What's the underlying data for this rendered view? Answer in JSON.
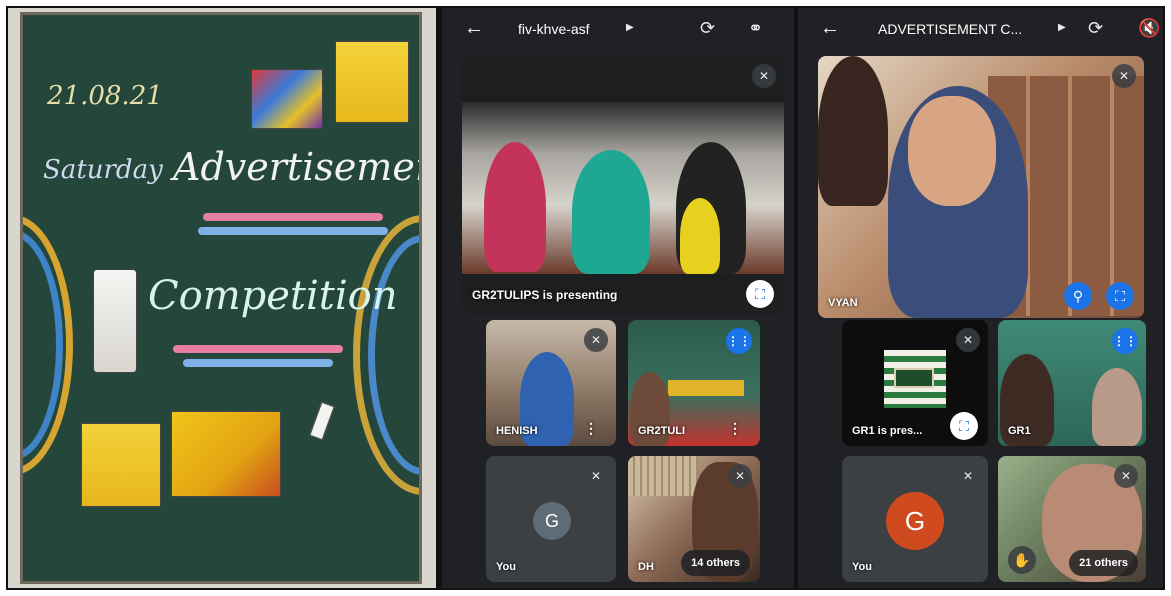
{
  "board": {
    "date": "21.08.21",
    "day": "Saturday",
    "title1": "Advertisement",
    "title2": "Competition"
  },
  "meet1": {
    "title": "fiv-khve-asf",
    "back_icon": "arrow-left-icon",
    "presenting_label": "GR2TULIPS is presenting",
    "tiles": {
      "henish": "HENISH",
      "gr2tuli": "GR2TULI",
      "you": "You",
      "you_initial": "G",
      "dh": "DH",
      "others": "14 others"
    }
  },
  "meet2": {
    "title": "ADVERTISEMENT C...",
    "back_icon": "arrow-left-icon",
    "tiles": {
      "vyan": "VYAN",
      "gr1_presenting": "GR1 is pres...",
      "gr1": "GR1",
      "you": "You",
      "you_initial": "G",
      "others": "21 others"
    }
  },
  "colors": {
    "meet_bg": "#202124",
    "tile_bg": "#3c4043",
    "accent_blue": "#1a73e8",
    "avatar_slate": "#5f6b75",
    "avatar_orange": "#d04a1f",
    "board_green": "#25463a"
  }
}
